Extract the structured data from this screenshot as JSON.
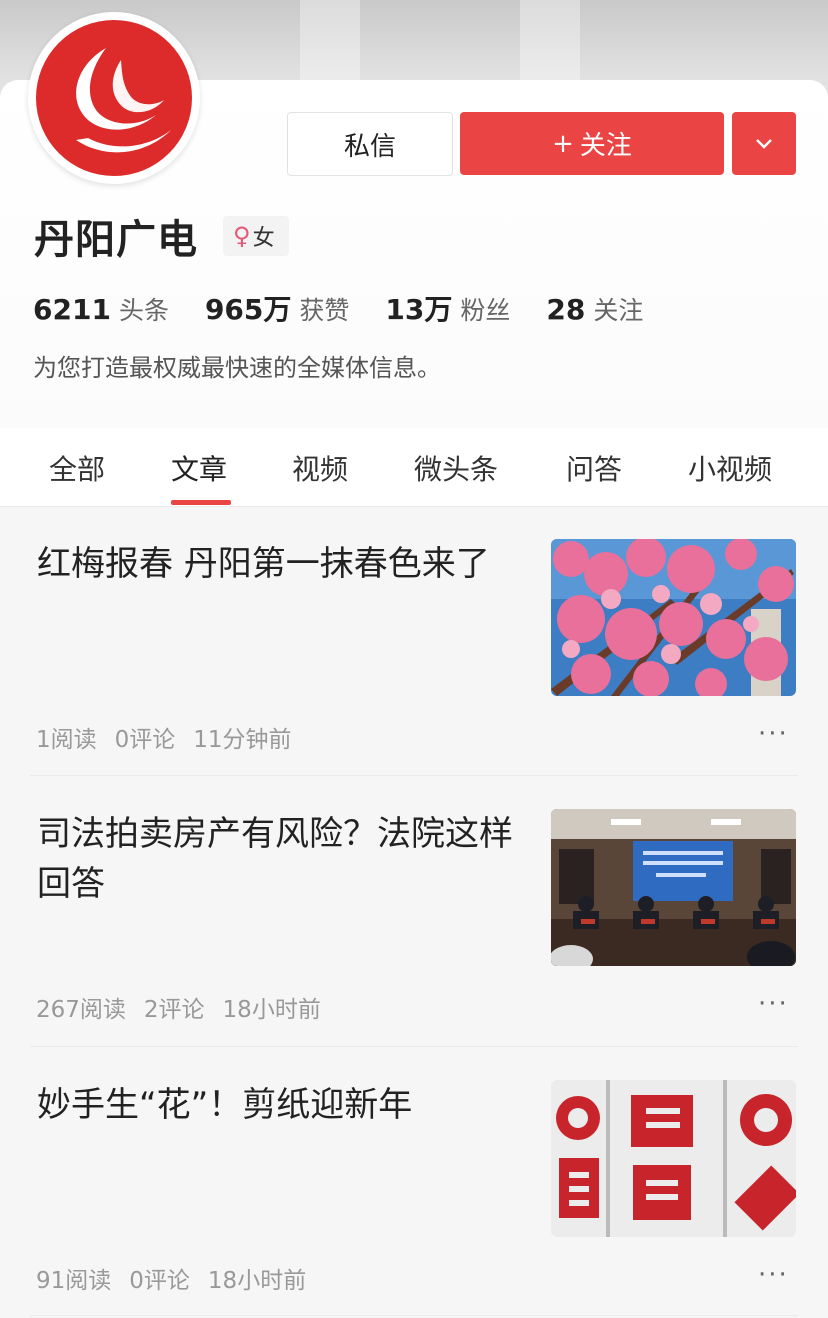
{
  "profile": {
    "name": "丹阳广电",
    "gender_icon": "female-icon",
    "gender_symbol": "♀",
    "gender_label": "女",
    "message_button": "私信",
    "follow_button": "关注",
    "follow_plus": "+",
    "description": "为您打造最权威最快速的全媒体信息。",
    "brand_color": "#ea4444"
  },
  "stats": [
    {
      "value": "6211",
      "label": "头条"
    },
    {
      "value": "965万",
      "label": "获赞"
    },
    {
      "value": "13万",
      "label": "粉丝"
    },
    {
      "value": "28",
      "label": "关注"
    }
  ],
  "tabs": [
    {
      "label": "全部",
      "active": false
    },
    {
      "label": "文章",
      "active": true
    },
    {
      "label": "视频",
      "active": false
    },
    {
      "label": "微头条",
      "active": false
    },
    {
      "label": "问答",
      "active": false
    },
    {
      "label": "小视频",
      "active": false
    }
  ],
  "articles": [
    {
      "title": "红梅报春 丹阳第一抹春色来了",
      "reads": "1阅读",
      "comments": "0评论",
      "time": "11分钟前",
      "thumb": "plum-blossom-photo"
    },
    {
      "title": "司法拍卖房产有风险？法院这样回答",
      "reads": "267阅读",
      "comments": "2评论",
      "time": "18小时前",
      "thumb": "press-conference-photo"
    },
    {
      "title": "妙手生“花”！剪纸迎新年",
      "reads": "91阅读",
      "comments": "0评论",
      "time": "18小时前",
      "thumb": "paper-cutting-photo"
    }
  ],
  "more_symbol": "···"
}
